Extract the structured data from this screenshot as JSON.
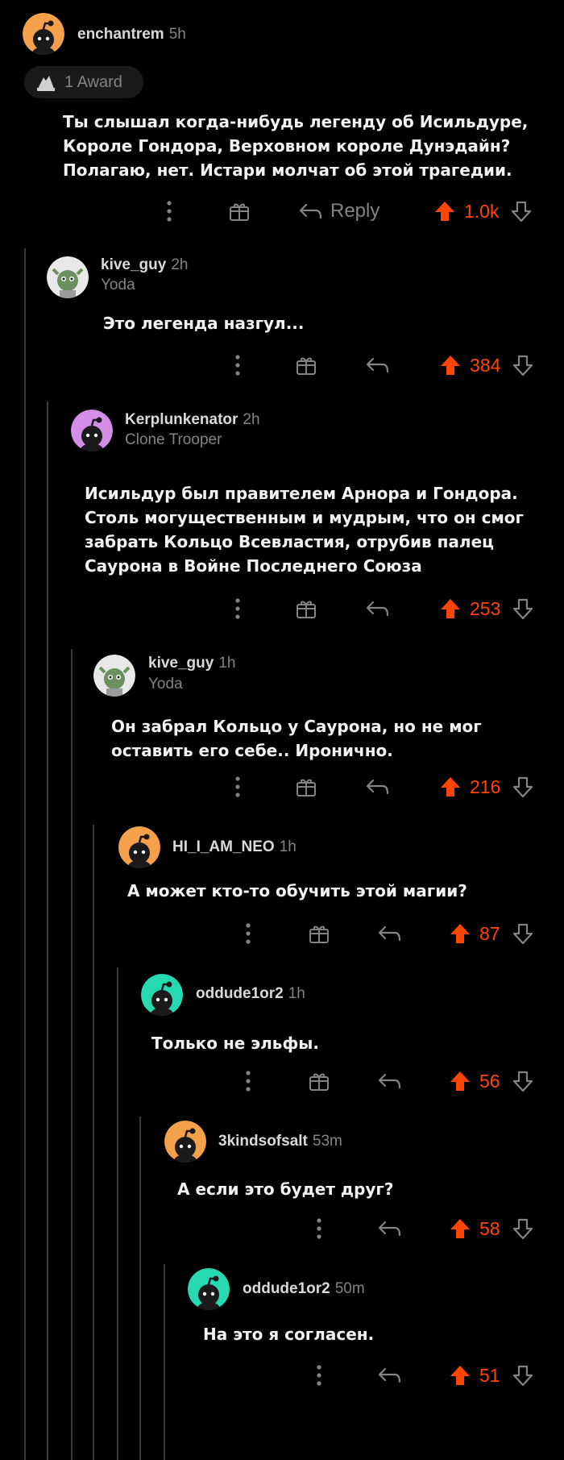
{
  "colors": {
    "upvote": "#ff4500",
    "thread_line": "#3a3a3c",
    "muted": "#818384"
  },
  "icons": {
    "more": "more-vertical-icon",
    "award": "gift-award-icon",
    "reply": "reply-arrow-icon",
    "upvote": "upvote-arrow-icon",
    "downvote": "downvote-arrow-icon"
  },
  "award": {
    "label": "1 Award"
  },
  "comments": [
    {
      "username": "enchantrem",
      "time": "5h",
      "flair": "",
      "avatar": "orange-snoo",
      "text": "Ты слышал когда-нибудь легенду об Исильдуре,\nКороле Гондора, Верховном короле Дунэдайн?\nПолагаю, нет. Истари молчат об этой трагедии.",
      "reply_label": "Reply",
      "score": "1.0k"
    },
    {
      "username": "kive_guy",
      "time": "2h",
      "flair": "Yoda",
      "avatar": "custom-snoo",
      "text": "Это легенда назгул...",
      "reply_label": "",
      "score": "384"
    },
    {
      "username": "Kerplunkenator",
      "time": "2h",
      "flair": "Clone Trooper",
      "avatar": "purple-snoo",
      "text": "Исильдур был правителем Арнора и Гондора.\nСтоль могущественным и мудрым, что он смог\nзабрать Кольцо Всевластия, отрубив палец\nСаурона в Войне Последнего Союза",
      "reply_label": "",
      "score": "253"
    },
    {
      "username": "kive_guy",
      "time": "1h",
      "flair": "Yoda",
      "avatar": "custom-snoo",
      "text": "Он забрал Кольцо у Саурона, но не мог\nоставить его себе.. Иронично.",
      "reply_label": "",
      "score": "216"
    },
    {
      "username": "HI_I_AM_NEO",
      "time": "1h",
      "flair": "",
      "avatar": "orange-snoo",
      "text": "А может кто-то обучить этой магии?",
      "reply_label": "",
      "score": "87"
    },
    {
      "username": "oddude1or2",
      "time": "1h",
      "flair": "",
      "avatar": "teal-snoo",
      "text": "Только не эльфы.",
      "reply_label": "",
      "score": "56"
    },
    {
      "username": "3kindsofsalt",
      "time": "53m",
      "flair": "",
      "avatar": "orange-snoo",
      "text": "А если это будет друг?",
      "reply_label": "",
      "score": "58"
    },
    {
      "username": "oddude1or2",
      "time": "50m",
      "flair": "",
      "avatar": "teal-snoo",
      "text": "На это я согласен.",
      "reply_label": "",
      "score": "51"
    }
  ]
}
